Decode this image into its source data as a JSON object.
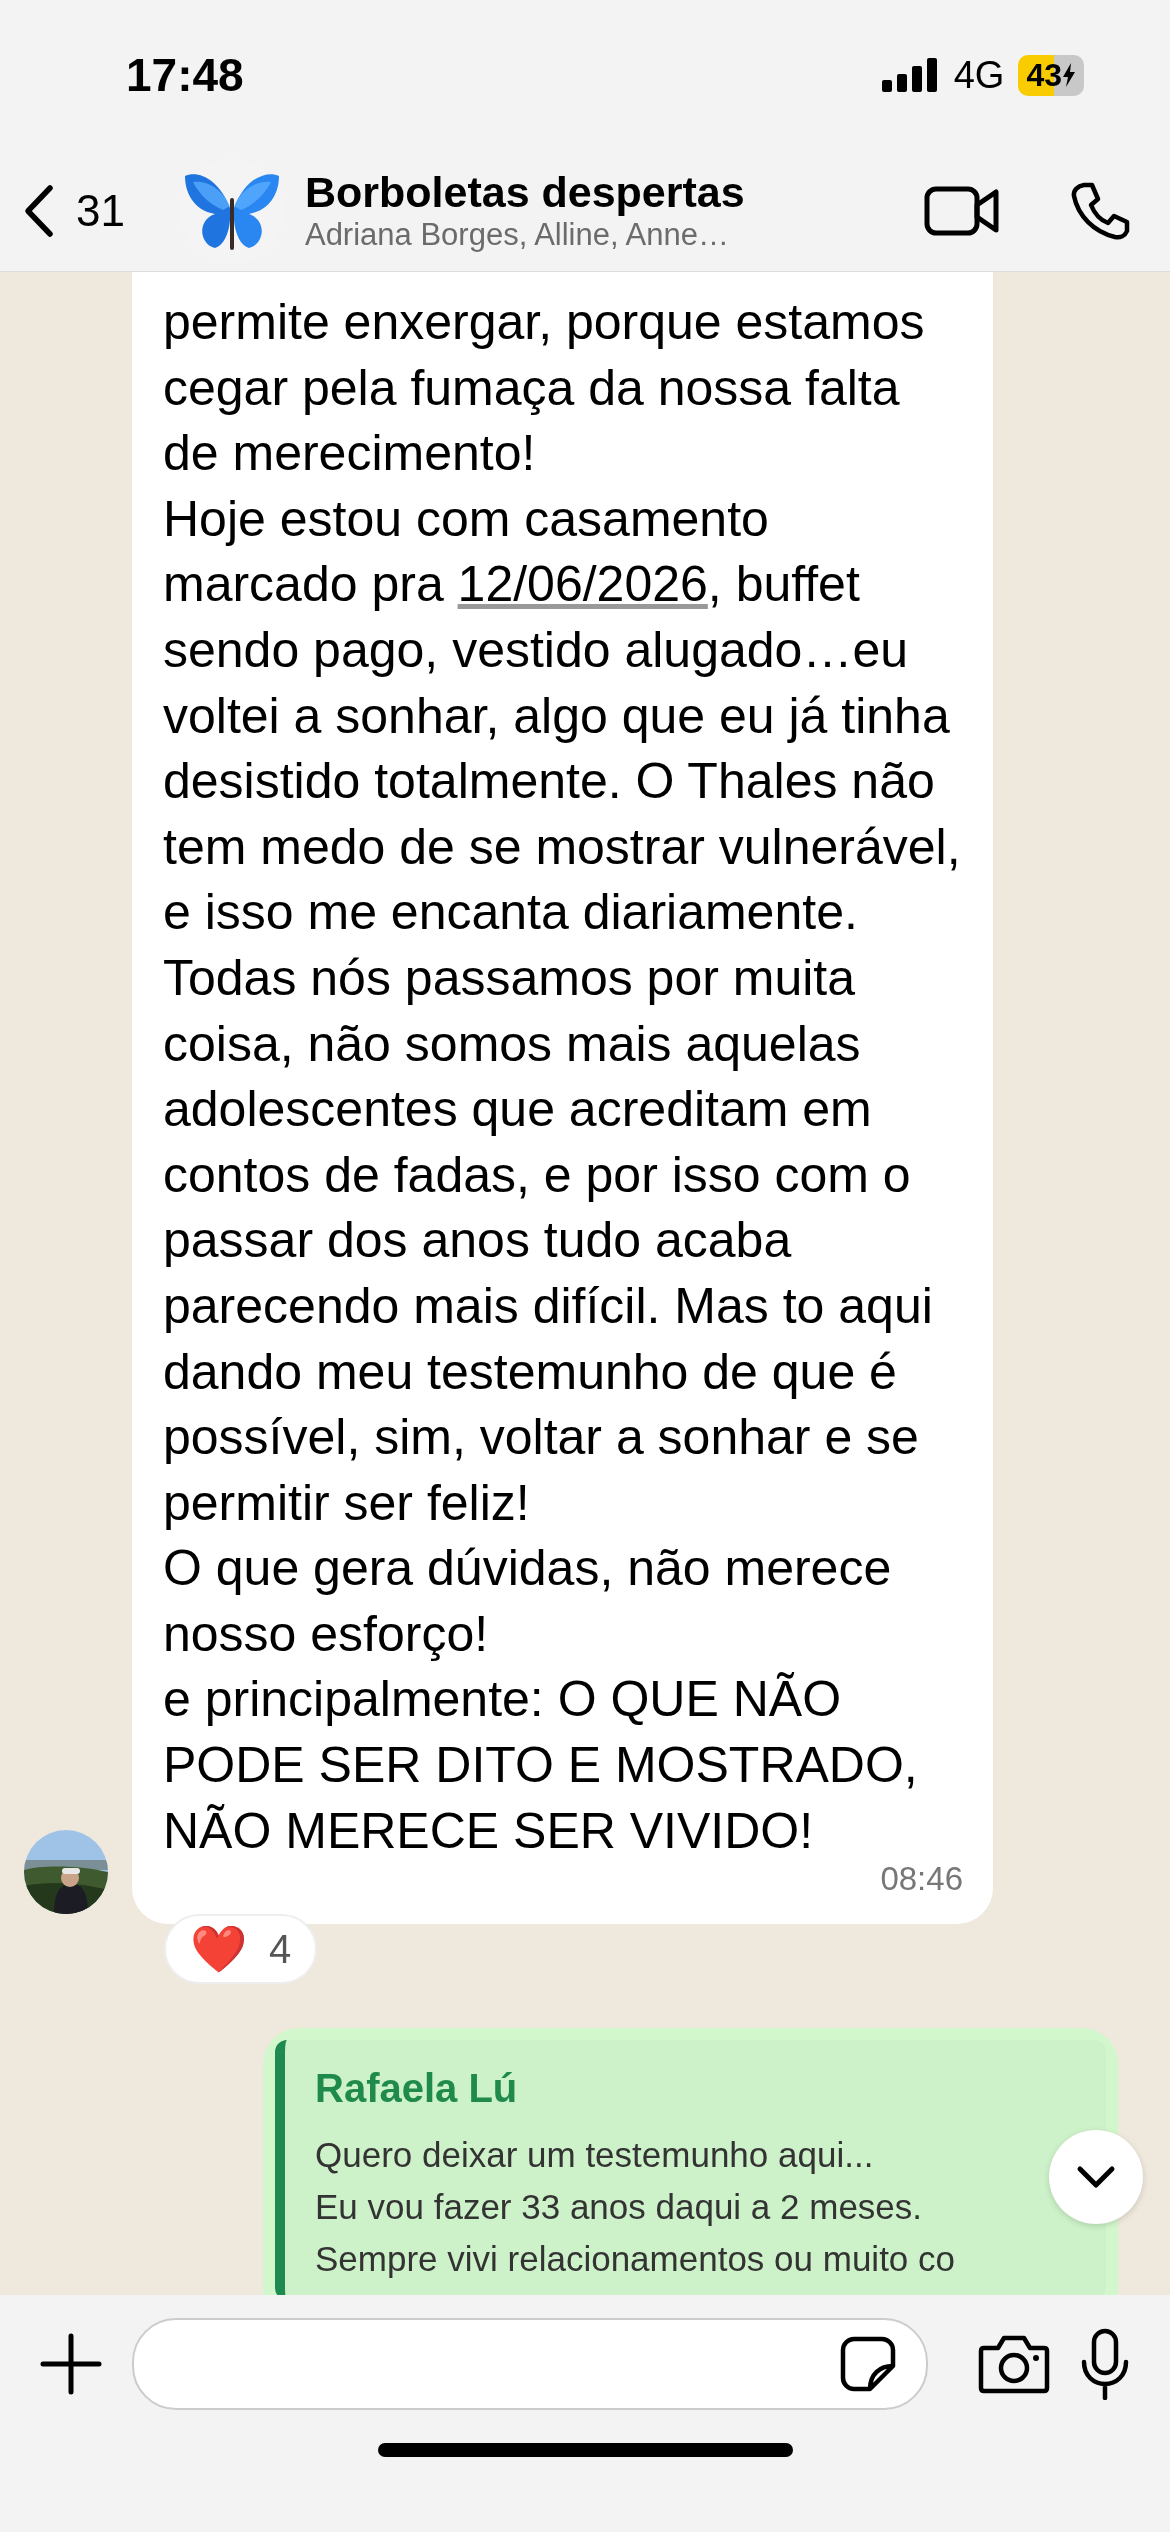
{
  "status_bar": {
    "time": "17:48",
    "network": "4G",
    "battery": "43"
  },
  "header": {
    "back_count": "31",
    "title": "Borboletas despertas",
    "subtitle": "Adriana Borges, Alline, Anne…"
  },
  "message": {
    "paragraphs": [
      [
        {
          "kind": "text",
          "text": "permite enxergar, porque estamos cegar pela fumaça da nossa falta de merecimento!"
        }
      ],
      [
        {
          "kind": "text",
          "text": "Hoje estou com casamento marcado pra "
        },
        {
          "kind": "link",
          "text": "12/06/2026"
        },
        {
          "kind": "text",
          "text": ", buffet sendo pago, vestido alugado…eu voltei a sonhar, algo que eu já tinha desistido totalmente. O Thales não tem medo de se mostrar vulnerável, e isso me encanta diariamente."
        }
      ],
      [
        {
          "kind": "text",
          "text": "Todas nós passamos por muita coisa, não somos mais aquelas adolescentes que acreditam em contos de fadas, e por isso com o passar dos anos tudo acaba parecendo mais difícil. Mas to aqui dando meu testemunho de que é possível, sim, voltar a sonhar e se permitir ser feliz!"
        }
      ],
      [
        {
          "kind": "text",
          "text": "O que gera dúvidas, não merece nosso esforço!"
        }
      ],
      [
        {
          "kind": "text",
          "text": "e principalmente: O QUE NÃO PODE SER DITO E MOSTRADO, NÃO MERECE SER VIVIDO!"
        }
      ]
    ],
    "time": "08:46",
    "reaction": {
      "emoji": "❤️",
      "count": "4"
    }
  },
  "reply": {
    "sender": "Rafaela Lú",
    "lines": [
      "Quero deixar um testemunho aqui...",
      "Eu vou fazer 33 anos daqui a 2 meses.",
      "Sempre vivi relacionamentos ou muito co"
    ]
  }
}
